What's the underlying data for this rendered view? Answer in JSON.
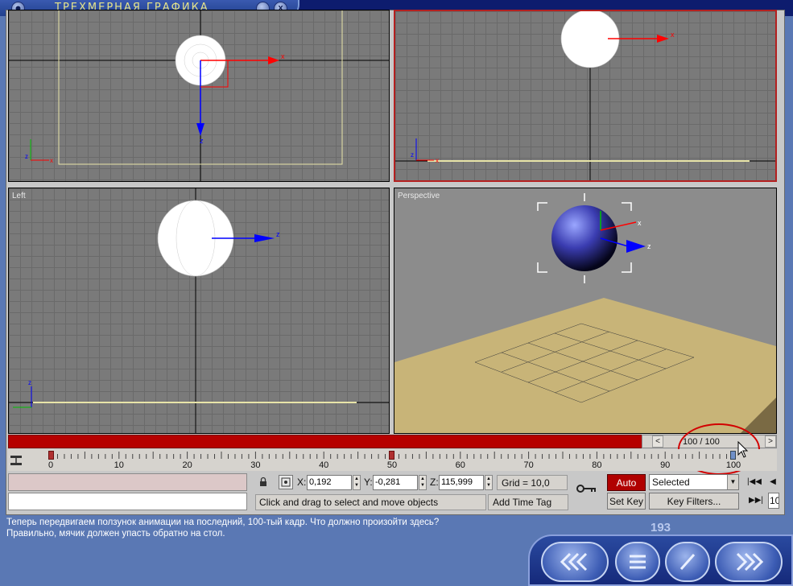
{
  "window": {
    "title": "ТРЕХМЕРНАЯ ГРАФИКА",
    "minimize_glyph": "_",
    "close_glyph": "x"
  },
  "viewports": {
    "top_left": {
      "label": ""
    },
    "top_right": {
      "label": ""
    },
    "left": {
      "label": "Left"
    },
    "perspective": {
      "label": "Perspective"
    }
  },
  "timeslider": {
    "value": "100 / 100",
    "prev": "<",
    "next": ">"
  },
  "trackbar": {
    "ticks": [
      "0",
      "10",
      "20",
      "30",
      "40",
      "50",
      "60",
      "70",
      "80",
      "90",
      "100"
    ]
  },
  "coords": {
    "x_label": "X:",
    "x": "0,192",
    "y_label": "Y:",
    "y": "-0,281",
    "z_label": "Z:",
    "z": "115,999"
  },
  "grid": "Grid = 10,0",
  "prompt": "Click and drag to select and move objects",
  "add_time_tag": "Add Time Tag",
  "auto_key": "Auto Key",
  "set_key": "Set Key",
  "selection_dropdown": "Selected",
  "key_filters": "Key Filters...",
  "frame_field": "10",
  "tutor": {
    "line1": "Теперь  передвигаем ползунок анимации на последний, 100-тый кадр. Что должно произойти здесь?",
    "line2": "Правильно, мячик должен упасть обратно на стол.",
    "page_number": "193"
  },
  "colors": {
    "accent_red": "#b60000",
    "panel_blue": "#5a78b4"
  }
}
